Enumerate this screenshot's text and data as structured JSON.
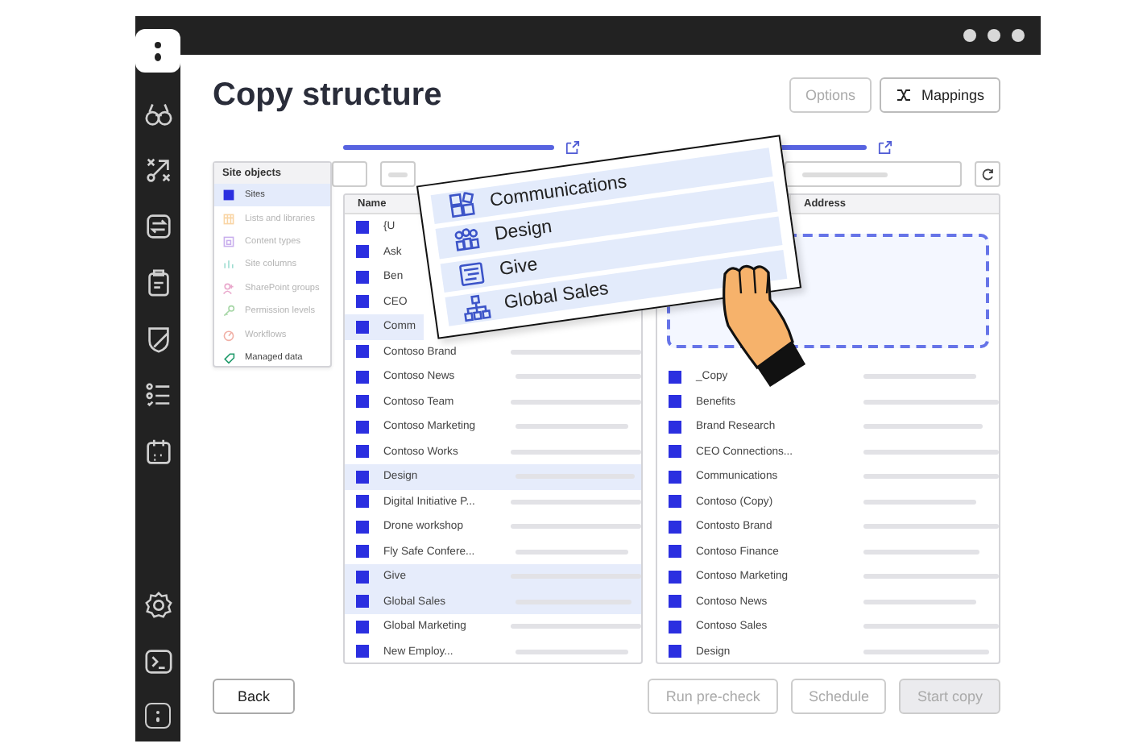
{
  "window": {
    "title": "Copy structure"
  },
  "header_buttons": [
    {
      "label": "Options",
      "kind": "plain",
      "disabled": true
    },
    {
      "label": "Mappings",
      "kind": "mappings",
      "disabled": false
    }
  ],
  "site_objects": {
    "title": "Site objects",
    "items": [
      {
        "label": "Sites",
        "kind": "sites",
        "selected": true,
        "disabled": false
      },
      {
        "label": "Lists and libraries",
        "kind": "lists",
        "selected": false,
        "disabled": true
      },
      {
        "label": "Content types",
        "kind": "content",
        "selected": false,
        "disabled": true
      },
      {
        "label": "Site columns",
        "kind": "columns",
        "selected": false,
        "disabled": true
      },
      {
        "label": "SharePoint groups",
        "kind": "groups",
        "selected": false,
        "disabled": true
      },
      {
        "label": "Permission levels",
        "kind": "permissions",
        "selected": false,
        "disabled": true
      },
      {
        "label": "Workflows",
        "kind": "workflows",
        "selected": false,
        "disabled": true
      },
      {
        "label": "Managed data",
        "kind": "managed",
        "selected": false,
        "disabled": false
      }
    ]
  },
  "source": {
    "columns": [
      "Name"
    ],
    "covered_rows": [
      {
        "name": "{U",
        "selected": false,
        "checked": true
      },
      {
        "name": "Ask",
        "selected": false,
        "checked": true
      },
      {
        "name": "Ben",
        "selected": false,
        "checked": true
      },
      {
        "name": "CEO",
        "selected": false,
        "checked": true
      },
      {
        "name": "Comm",
        "selected": true,
        "checked": true
      }
    ],
    "rows": [
      {
        "name": "Contoso Brand",
        "selected": false,
        "checked": true
      },
      {
        "name": "Contoso News",
        "selected": false,
        "checked": true
      },
      {
        "name": "Contoso Team",
        "selected": false,
        "checked": true
      },
      {
        "name": "Contoso Marketing",
        "selected": false,
        "checked": true
      },
      {
        "name": "Contoso Works",
        "selected": false,
        "checked": true
      },
      {
        "name": "Design",
        "selected": true,
        "checked": true
      },
      {
        "name": "Digital Initiative P...",
        "selected": false,
        "checked": true
      },
      {
        "name": "Drone workshop",
        "selected": false,
        "checked": true
      },
      {
        "name": "Fly Safe Confere...",
        "selected": false,
        "checked": true
      },
      {
        "name": "Give",
        "selected": true,
        "checked": true
      },
      {
        "name": "Global Sales",
        "selected": true,
        "checked": true
      },
      {
        "name": "Global Marketing",
        "selected": false,
        "checked": true
      },
      {
        "name": "New Employ...",
        "selected": false,
        "checked": true
      }
    ]
  },
  "target": {
    "columns": [
      "Address"
    ],
    "rows": [
      {
        "name": "_Copy",
        "checked": true
      },
      {
        "name": "Benefits",
        "checked": true
      },
      {
        "name": "Brand Research",
        "checked": true
      },
      {
        "name": "CEO Connections...",
        "checked": true
      },
      {
        "name": "Communications",
        "checked": true
      },
      {
        "name": "Contoso (Copy)",
        "checked": true
      },
      {
        "name": "Contosto Brand",
        "checked": true
      },
      {
        "name": "Contoso Finance",
        "checked": true
      },
      {
        "name": "Contoso Marketing",
        "checked": true
      },
      {
        "name": "Contoso News",
        "checked": true
      },
      {
        "name": "Contoso Sales",
        "checked": true
      },
      {
        "name": "Design",
        "checked": true
      }
    ]
  },
  "drag_card": {
    "items": [
      {
        "label": "Communications",
        "kind": "tiles"
      },
      {
        "label": "Design",
        "kind": "people"
      },
      {
        "label": "Give",
        "kind": "list"
      },
      {
        "label": "Global Sales",
        "kind": "org"
      }
    ]
  },
  "footer": {
    "back": "Back",
    "actions": [
      {
        "label": "Run pre-check",
        "kind": "outline",
        "disabled": true
      },
      {
        "label": "Schedule",
        "kind": "outline",
        "disabled": true
      },
      {
        "label": "Start copy",
        "kind": "primary",
        "disabled": true
      }
    ]
  }
}
